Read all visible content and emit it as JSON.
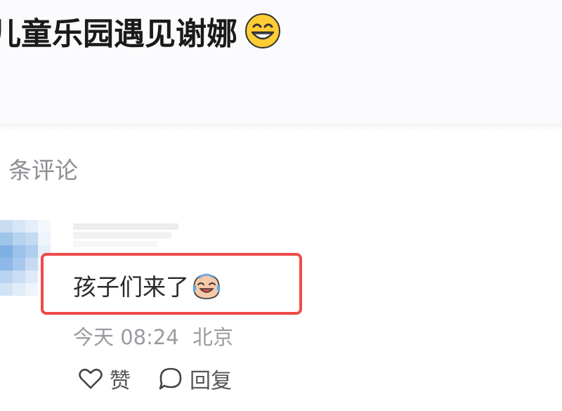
{
  "post": {
    "title": "儿童乐园遇见谢娜",
    "title_emoji": "grinning-face"
  },
  "comments_header": {
    "label": "条评论"
  },
  "comment": {
    "text": "孩子们来了",
    "text_emoji": "face-with-tears-of-joy",
    "date": "今天 08:24",
    "location": "北京",
    "like_label": "赞",
    "reply_label": "回复"
  },
  "colors": {
    "highlight_border": "#f04a4a",
    "title_text": "#1a1a1a",
    "meta_text": "#9a9aa0"
  }
}
